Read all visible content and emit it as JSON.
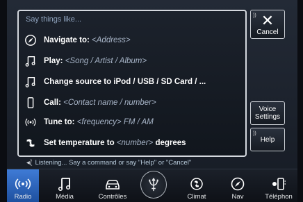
{
  "voice": {
    "prompt_title": "Say things like...",
    "commands": [
      {
        "icon": "compass-icon",
        "label": "Navigate to:",
        "hint": "<Address>"
      },
      {
        "icon": "music-note-icon",
        "label": "Play:",
        "hint": "<Song / Artist / Album>"
      },
      {
        "icon": "music-note-icon",
        "label": "Change source to iPod / USB / SD Card / ...",
        "hint": ""
      },
      {
        "icon": "phone-icon",
        "label": "Call:",
        "hint": "<Contact name / number>"
      },
      {
        "icon": "radio-wave-icon",
        "label": "Tune to:",
        "hint": "<frequency> FM / AM"
      },
      {
        "icon": "fan-icon",
        "label": "Set temperature to",
        "hint": "<number>",
        "suffix": "degrees"
      }
    ]
  },
  "buttons": {
    "cancel_label": "Cancel",
    "voice_settings_line1": "Voice",
    "voice_settings_line2": "Settings",
    "help_label": "Help"
  },
  "status_text": "Listening... Say a command or say \"Help\" or \"Cancel\"",
  "nav": {
    "items": [
      {
        "label": "Radio",
        "icon": "radio-icon",
        "active": true
      },
      {
        "label": "Média",
        "icon": "music-note-icon"
      },
      {
        "label": "Contrôles",
        "icon": "car-icon"
      },
      {
        "label": "Climat",
        "icon": "fan-icon"
      },
      {
        "label": "Nav",
        "icon": "compass-icon"
      },
      {
        "label": "Téléphon",
        "icon": "phone-icon"
      }
    ]
  },
  "colors": {
    "accent": "#2f6cc8",
    "panel_border": "#d4d8de"
  }
}
